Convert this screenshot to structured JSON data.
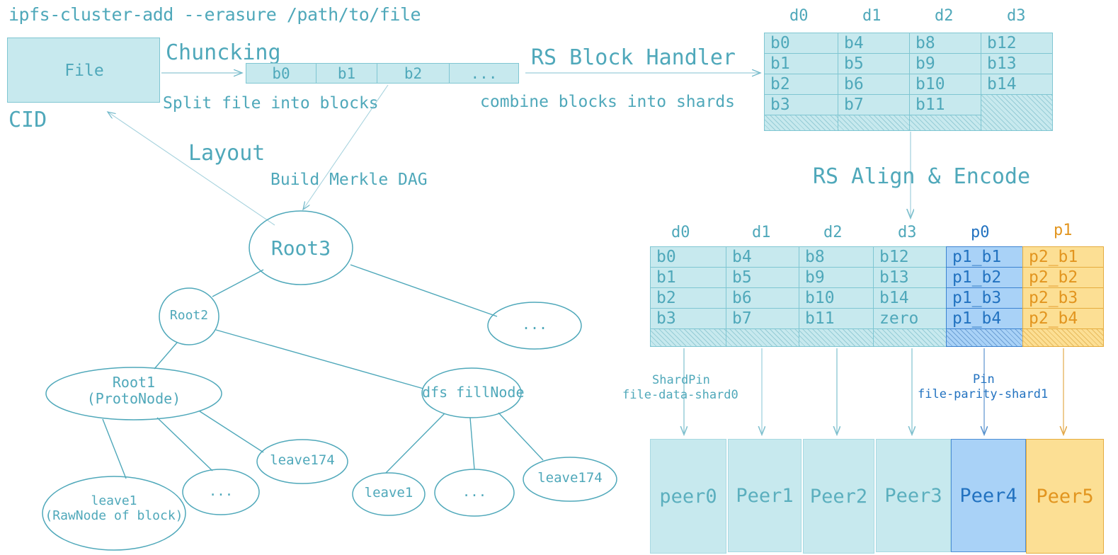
{
  "command": "ipfs-cluster-add --erasure /path/to/file",
  "file_box": {
    "label": "File"
  },
  "cid_label": "CID",
  "stages": {
    "chunking": "Chuncking",
    "chunking_sub": "Split file into blocks",
    "rs_block_handler": "RS Block Handler",
    "rs_block_handler_sub": "combine blocks into shards",
    "layout": "Layout",
    "build_merkle_dag": "Build Merkle DAG",
    "rs_align_encode": "RS Align & Encode"
  },
  "chunk_blocks": [
    "b0",
    "b1",
    "b2",
    "..."
  ],
  "shard_table": {
    "columns": [
      "d0",
      "d1",
      "d2",
      "d3"
    ],
    "rows": [
      [
        "b0",
        "b4",
        "b8",
        "b12"
      ],
      [
        "b1",
        "b5",
        "b9",
        "b13"
      ],
      [
        "b2",
        "b6",
        "b10",
        "b14"
      ],
      [
        "b3",
        "b7",
        "b11",
        ""
      ]
    ]
  },
  "encoded_table": {
    "columns": [
      "d0",
      "d1",
      "d2",
      "d3",
      "p0",
      "p1"
    ],
    "rows": [
      [
        "b0",
        "b4",
        "b8",
        "b12",
        "p1_b1",
        "p2_b1"
      ],
      [
        "b1",
        "b5",
        "b9",
        "b13",
        "p1_b2",
        "p2_b2"
      ],
      [
        "b2",
        "b6",
        "b10",
        "b14",
        "p1_b3",
        "p2_b3"
      ],
      [
        "b3",
        "b7",
        "b11",
        "zero",
        "p1_b4",
        "p2_b4"
      ]
    ]
  },
  "pin_labels": {
    "shard_pin_title": "ShardPin",
    "shard_pin_name": "file-data-shard0",
    "pin_title": "Pin",
    "pin_name": "file-parity-shard1"
  },
  "peers": [
    "peer0",
    "Peer1",
    "Peer2",
    "Peer3",
    "Peer4",
    "Peer5"
  ],
  "dag": {
    "root3": "Root3",
    "root2": "Root2",
    "root1": "Root1\n(ProtoNode)",
    "ellipsis_top": "...",
    "dfs_fillnode": "dfs fillNode",
    "leave1_raw": "leave1\n(RawNode of block)",
    "ellipsis_left": "...",
    "leave174_left": "leave174",
    "leave1_right": "leave1",
    "ellipsis_right": "...",
    "leave174_right": "leave174"
  },
  "colors": {
    "teal_text": "#4FA8BA",
    "teal_fill": "#C7E9EE",
    "teal_stroke": "#7FC6D2",
    "blue_text": "#2272C0",
    "blue_fill": "#A9D2F7",
    "blue_stroke": "#3C83D0",
    "orange_text": "#E2951F",
    "orange_fill": "#FCDF94",
    "orange_stroke": "#E5AC3E"
  }
}
